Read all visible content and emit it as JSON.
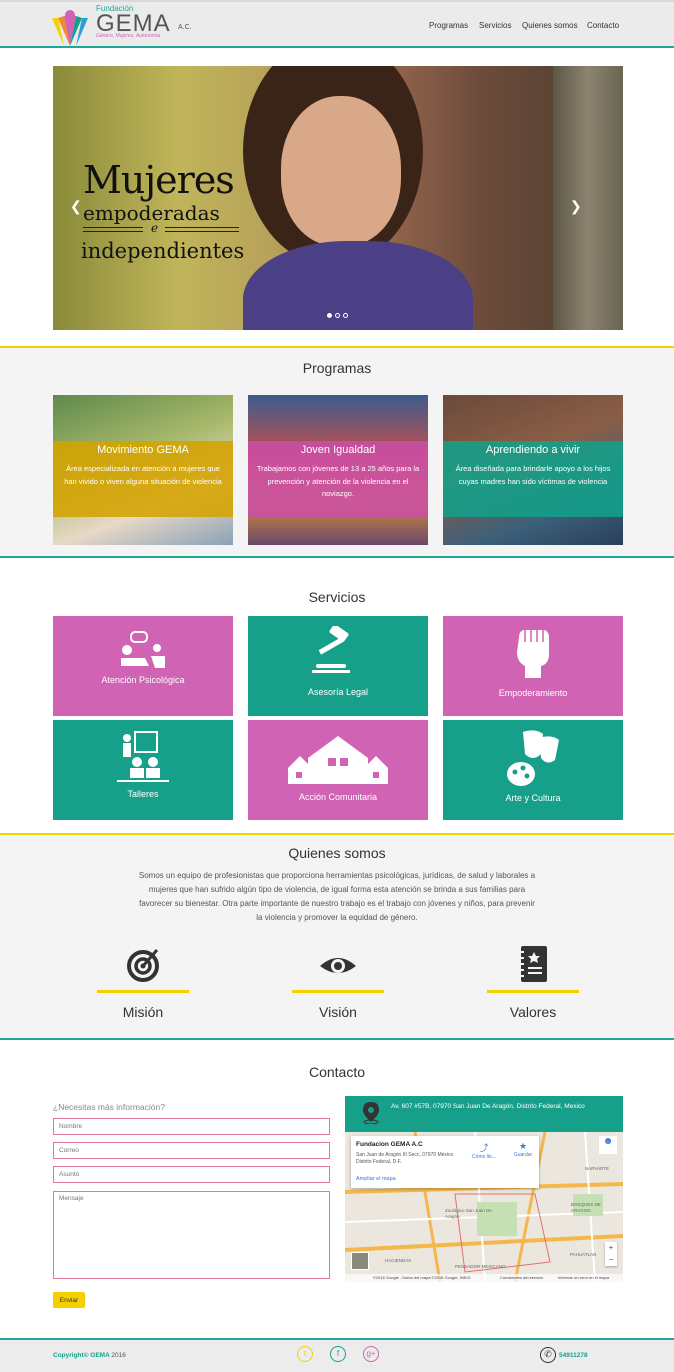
{
  "header": {
    "brand_small": "Fundación",
    "brand_name": "GEMA",
    "brand_suffix": "A.C.",
    "brand_tagline": "Género, Mujeres, Autonomía",
    "nav": [
      "Programas",
      "Servicios",
      "Quienes somos",
      "Contacto"
    ]
  },
  "hero": {
    "line1": "Mujeres",
    "line2": "empoderadas",
    "line3": "e",
    "line4": "independientes",
    "slides": 3,
    "active_slide": 1
  },
  "programas": {
    "title": "Programas",
    "cards": [
      {
        "title": "Movimiento GEMA",
        "desc": "Área especializada en atención a mujeres que han vivido o viven alguna situación de violencia",
        "color": "#d4a300"
      },
      {
        "title": "Joven Igualdad",
        "desc": "Trabajamos con jóvenes de 13 a 25 años para la prevención y atención de la violencia en el noviazgo.",
        "color": "#c94fa6"
      },
      {
        "title": "Aprendiendo a vivir",
        "desc": "Área diseñada para brindarle apoyo a los hijos cuyas madres han sido víctimas de violencia",
        "color": "#12a08a"
      }
    ]
  },
  "servicios": {
    "title": "Servicios",
    "items": [
      {
        "label": "Atención Psicológica",
        "icon": "therapy-icon"
      },
      {
        "label": "Asesoría Legal",
        "icon": "gavel-icon"
      },
      {
        "label": "Empoderamiento",
        "icon": "fist-icon"
      },
      {
        "label": "Talleres",
        "icon": "classroom-icon"
      },
      {
        "label": "Acción Comunitaria",
        "icon": "houses-icon"
      },
      {
        "label": "Arte y Cultura",
        "icon": "masks-palette-icon"
      }
    ]
  },
  "quienes": {
    "title": "Quienes somos",
    "text": "Somos un equipo de profesionistas que proporciona herramientas psicológicas, jurídicas, de salud y laborales a mujeres que han sufrido algún tipo de violencia, de igual forma esta atención se brinda a sus familias para favorecer su bienestar. Otra parte importante de nuestro trabajo es el trabajo con jóvenes y niños, para prevenir la violencia y promover la equidad de género.",
    "pillars": [
      {
        "label": "Misión",
        "icon": "target-icon"
      },
      {
        "label": "Visión",
        "icon": "eye-icon"
      },
      {
        "label": "Valores",
        "icon": "notebook-icon"
      }
    ]
  },
  "contacto": {
    "title": "Contacto",
    "question": "¿Necesitas más información?",
    "name_placeholder": "Nombre",
    "email_placeholder": "Correo",
    "subject_placeholder": "Asunto",
    "message_placeholder": "Mensaje",
    "send_label": "Enviar",
    "address": "Av. 607 #57B, 07970 San Juan De Aragón, Distrito Federal, Mexico",
    "map": {
      "place_name": "Fundacion GEMA A.C",
      "place_addr": "San Juan de Aragón III Secc, 07970 México Distrito Federal, D.F.",
      "directions": "Cómo lle...",
      "save": "Guardar",
      "enlarge": "Ampliar el mapa",
      "labels": [
        "NARVARTE",
        "BOSQUES DE ARAGON",
        "Zoológico San Juan De Aragón",
        "HACIENDAS",
        "PENSADOR MEXICANO",
        "PAHUATLAN"
      ],
      "attribution": "©2016 Google - Datos del mapa ©2016 Google, INEGI",
      "terms": "Condiciones del servicio",
      "report": "Informar un error en el mapa"
    }
  },
  "footer": {
    "copyright": "Copyright© GEMA",
    "year": "2016",
    "phone": "54911278",
    "social": [
      "twitter-icon",
      "facebook-icon",
      "google-plus-icon"
    ],
    "accent": "#1fa89a"
  }
}
